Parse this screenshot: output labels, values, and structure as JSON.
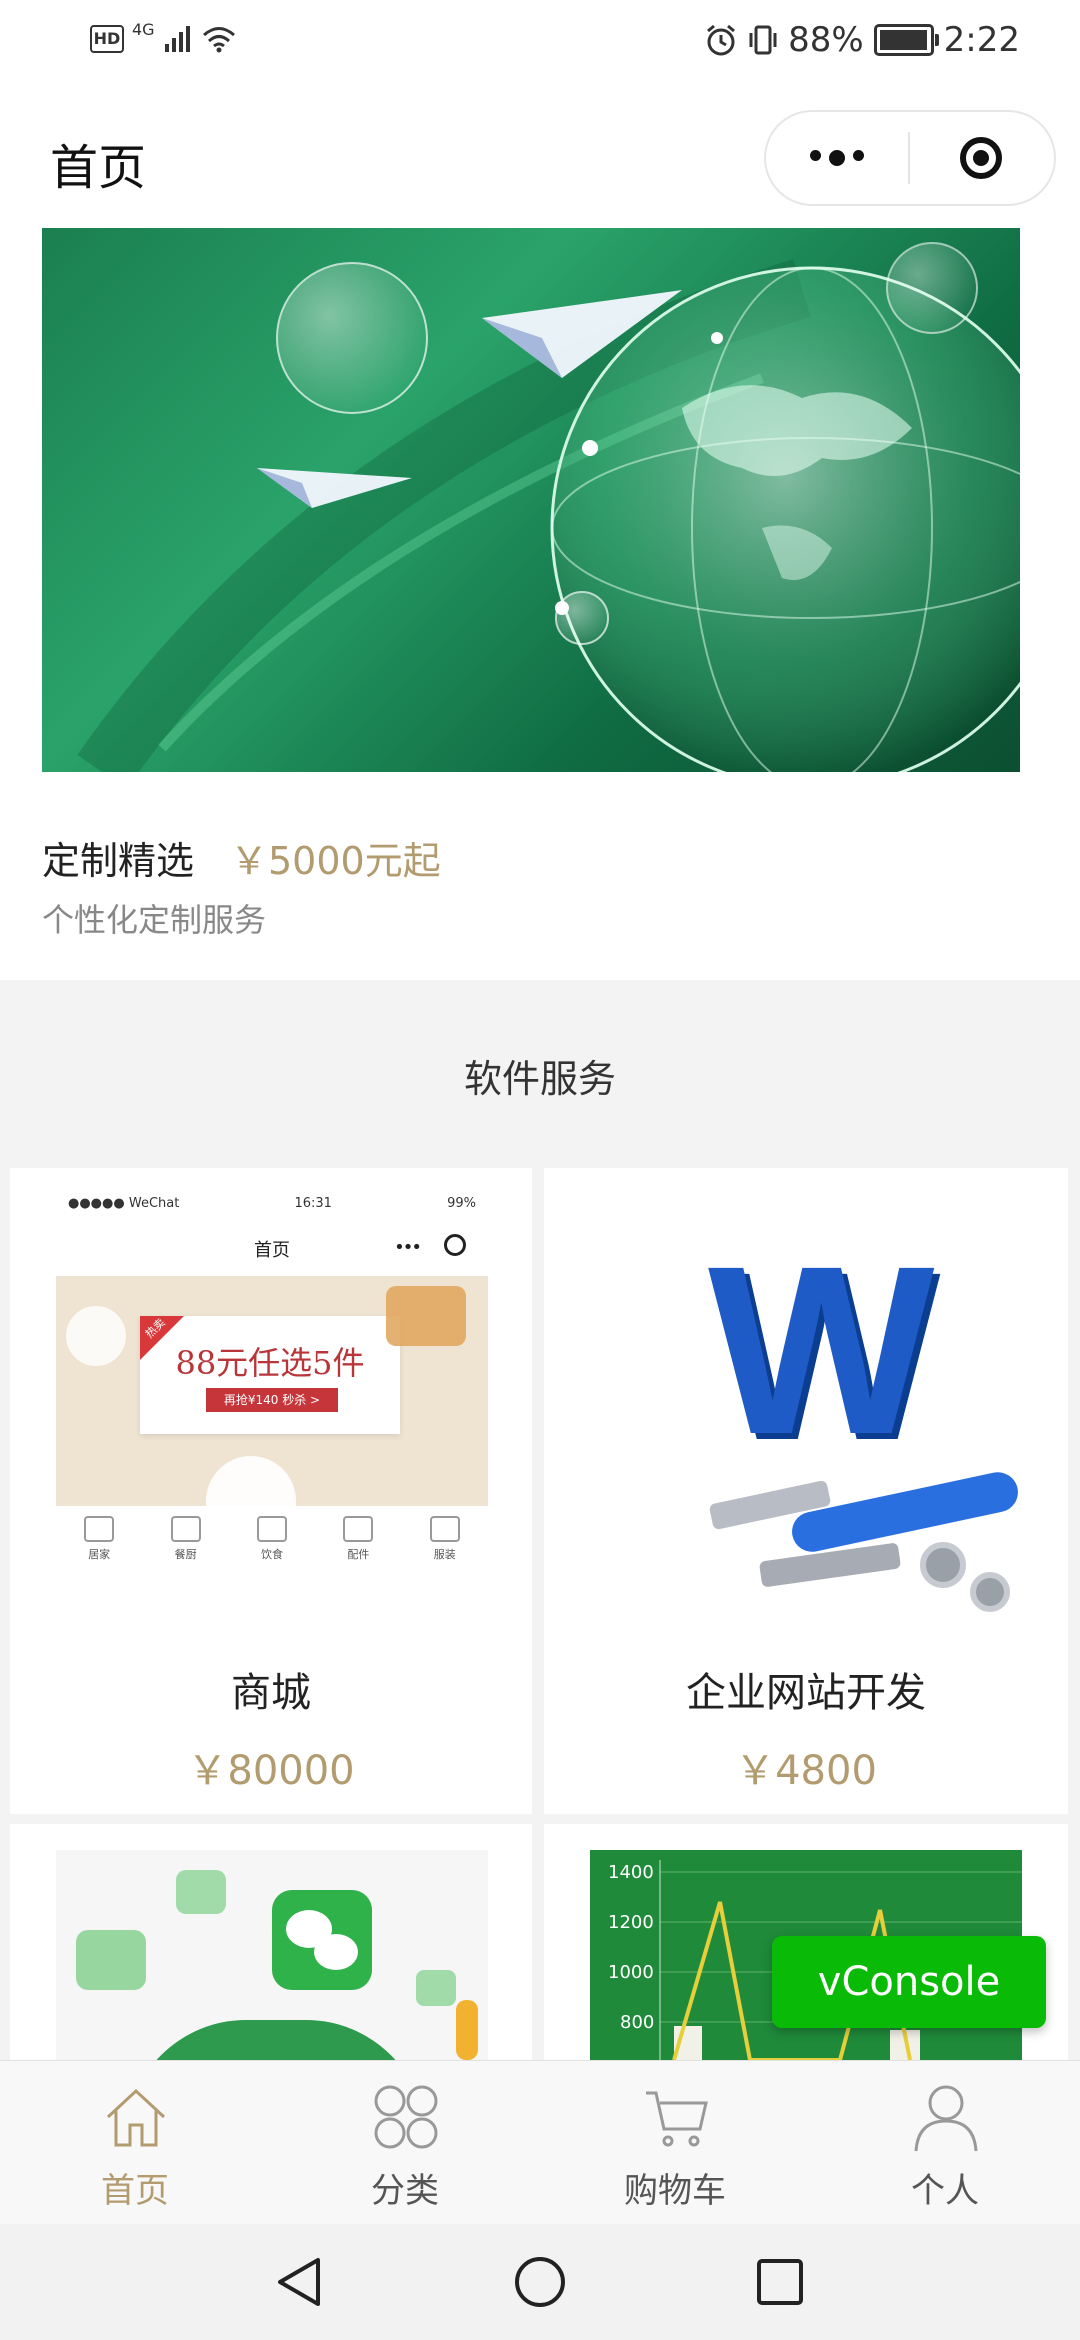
{
  "status_bar": {
    "hd": "HD",
    "network": "4G",
    "battery": "88%",
    "battery_level": 0.88,
    "time": "2:22"
  },
  "nav": {
    "title": "首页",
    "more_icon": "more-dots-icon",
    "close_icon": "record-target-icon"
  },
  "feature": {
    "title": "定制精选",
    "price": "￥5000元起",
    "subtitle": "个性化定制服务"
  },
  "section": {
    "title": "软件服务"
  },
  "cards": [
    {
      "name": "商城",
      "price": "￥80000",
      "screenshot": {
        "status_left": "●●●●● WeChat",
        "time": "16:31",
        "battery": "99%",
        "title": "首页",
        "promo": "88元任选5件",
        "promo_sub": "再抢¥140 秒杀 >",
        "corner_tag": "热卖",
        "categories": [
          "居家",
          "餐厨",
          "饮食",
          "配件",
          "服装"
        ]
      }
    },
    {
      "name": "企业网站开发",
      "price": "￥4800",
      "image_text": "W"
    },
    {
      "name": "",
      "price": ""
    },
    {
      "name": "",
      "price": "",
      "chart_ticks": [
        "1400",
        "1200",
        "1000",
        "800"
      ]
    }
  ],
  "tabs": [
    {
      "label": "首页",
      "icon": "home-icon",
      "active": true
    },
    {
      "label": "分类",
      "icon": "category-grid-icon",
      "active": false
    },
    {
      "label": "购物车",
      "icon": "cart-icon",
      "active": false
    },
    {
      "label": "个人",
      "icon": "user-icon",
      "active": false
    }
  ],
  "vconsole": {
    "label": "vConsole"
  },
  "colors": {
    "accent_gold": "#b29b6f",
    "vconsole_green": "#09bb07",
    "section_bg": "#f3f3f3"
  }
}
